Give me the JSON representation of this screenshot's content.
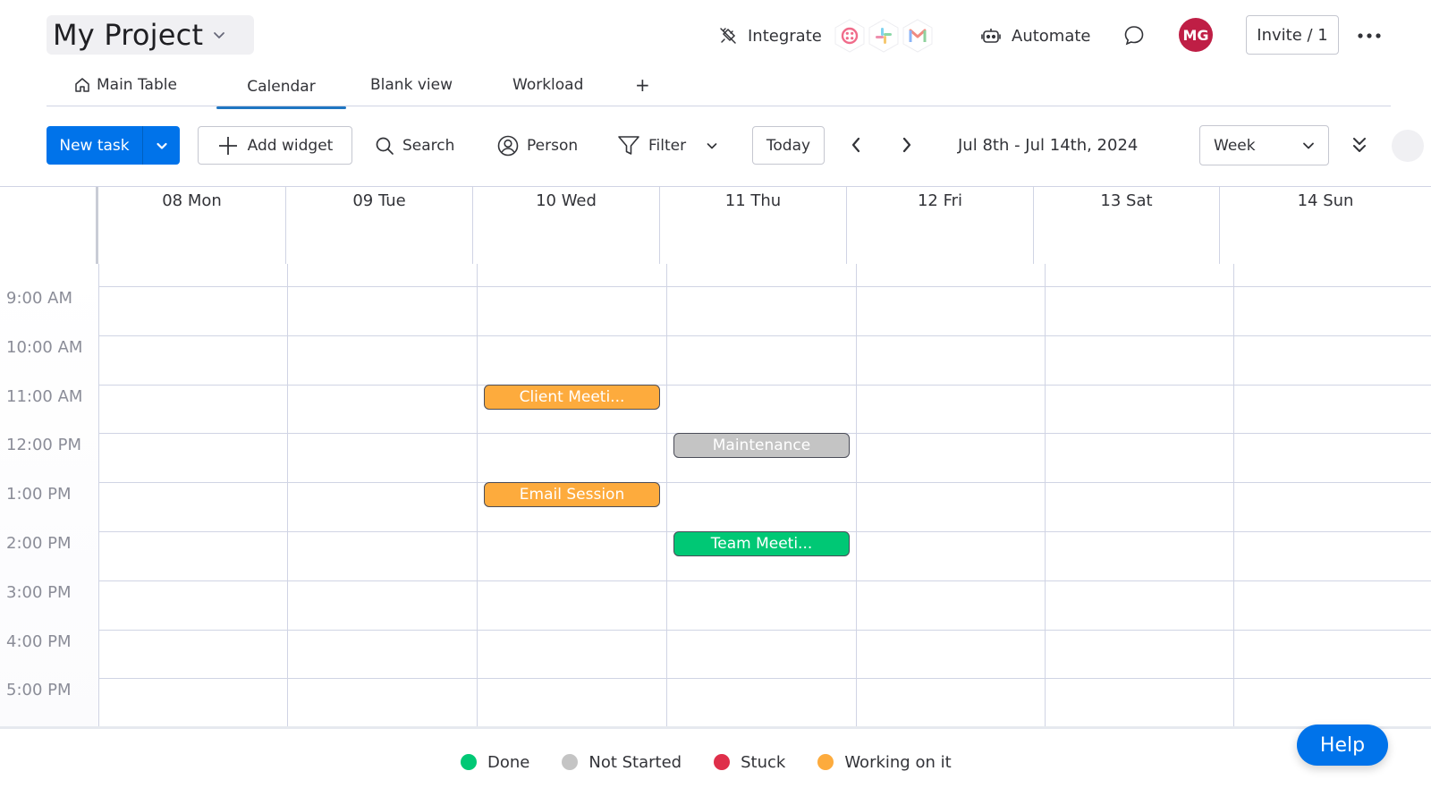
{
  "header": {
    "project_title": "My Project",
    "integrate_label": "Integrate",
    "integration_apps": [
      "twilio-icon",
      "slack-icon",
      "gmail-icon"
    ],
    "automate_label": "Automate",
    "avatar_initials": "MG",
    "avatar_color": "#bf1e45",
    "invite_label": "Invite / 1"
  },
  "tabs": [
    {
      "label": "Main Table",
      "icon": "home-icon",
      "active": false
    },
    {
      "label": "Calendar",
      "active": true
    },
    {
      "label": "Blank view",
      "active": false
    },
    {
      "label": "Workload",
      "active": false
    },
    {
      "label": "+",
      "active": false
    }
  ],
  "toolbar": {
    "new_task_label": "New task",
    "add_widget_label": "Add widget",
    "search_label": "Search",
    "person_label": "Person",
    "filter_label": "Filter",
    "today_label": "Today",
    "date_range": "Jul 8th - Jul 14th, 2024",
    "view_select": "Week",
    "accent_color": "#0073ea"
  },
  "calendar": {
    "days": [
      "08 Mon",
      "09 Tue",
      "10 Wed",
      "11 Thu",
      "12 Fri",
      "13 Sat",
      "14 Sun"
    ],
    "hours": [
      "9:00 AM",
      "10:00 AM",
      "11:00 AM",
      "12:00 PM",
      "1:00 PM",
      "2:00 PM",
      "3:00 PM",
      "4:00 PM",
      "5:00 PM"
    ],
    "events": [
      {
        "title": "Client Meeti...",
        "day": "10 Wed",
        "hour": "11:00 AM",
        "status": "Working on it"
      },
      {
        "title": "Maintenance",
        "day": "11 Thu",
        "hour": "12:00 PM",
        "status": "Not Started"
      },
      {
        "title": "Email Session",
        "day": "10 Wed",
        "hour": "1:00 PM",
        "status": "Working on it"
      },
      {
        "title": "Team Meeti...",
        "day": "11 Thu",
        "hour": "2:00 PM",
        "status": "Done"
      }
    ]
  },
  "legend": [
    {
      "label": "Done",
      "color": "#00c875"
    },
    {
      "label": "Not Started",
      "color": "#c4c4c4"
    },
    {
      "label": "Stuck",
      "color": "#df2f4a"
    },
    {
      "label": "Working on it",
      "color": "#fdab3d"
    }
  ],
  "help_label": "Help"
}
